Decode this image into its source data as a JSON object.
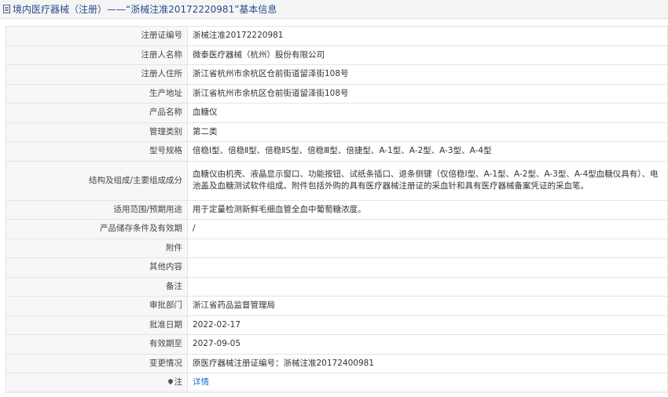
{
  "header": {
    "title": "境内医疗器械（注册）——“浙械注准20172220981”基本信息"
  },
  "rows": [
    {
      "label": "注册证编号",
      "value": "浙械注准20172220981"
    },
    {
      "label": "注册人名称",
      "value": "微泰医疗器械（杭州）股份有限公司"
    },
    {
      "label": "注册人住所",
      "value": "浙江省杭州市余杭区仓前街道留泽街108号"
    },
    {
      "label": "生产地址",
      "value": "浙江省杭州市余杭区仓前街道留泽街108号"
    },
    {
      "label": "产品名称",
      "value": "血糖仪"
    },
    {
      "label": "管理类别",
      "value": "第二类"
    },
    {
      "label": "型号规格",
      "value": "倍稳Ⅰ型、倍稳Ⅱ型、倍稳ⅡS型、倍稳Ⅲ型、倍捷型、A-1型、A-2型、A-3型、A-4型"
    },
    {
      "label": "结构及组成/主要组成成分",
      "value": "血糖仪由机壳、液晶显示窗口、功能按钮、试纸条插口、退条侧键（仅倍稳Ⅰ型、A-1型、A-2型、A-3型、A-4型血糖仪具有）、电池盖及血糖测试软件组成。附件包括外购的具有医疗器械注册证的采血针和具有医疗器械备案凭证的采血笔。"
    },
    {
      "label": "适用范围/预期用途",
      "value": "用于定量检测新鲜毛细血管全血中葡萄糖浓度。"
    },
    {
      "label": "产品储存条件及有效期",
      "value": "/"
    },
    {
      "label": "附件",
      "value": ""
    },
    {
      "label": "其他内容",
      "value": ""
    },
    {
      "label": "备注",
      "value": ""
    },
    {
      "label": "审批部门",
      "value": "浙江省药品监督管理局"
    },
    {
      "label": "批准日期",
      "value": "2022-02-17"
    },
    {
      "label": "有效期至",
      "value": "2027-09-05"
    },
    {
      "label": "变更情况",
      "value": "原医疗器械注册证编号：浙械注准20172400981"
    },
    {
      "label": "注",
      "value": "详情"
    }
  ]
}
